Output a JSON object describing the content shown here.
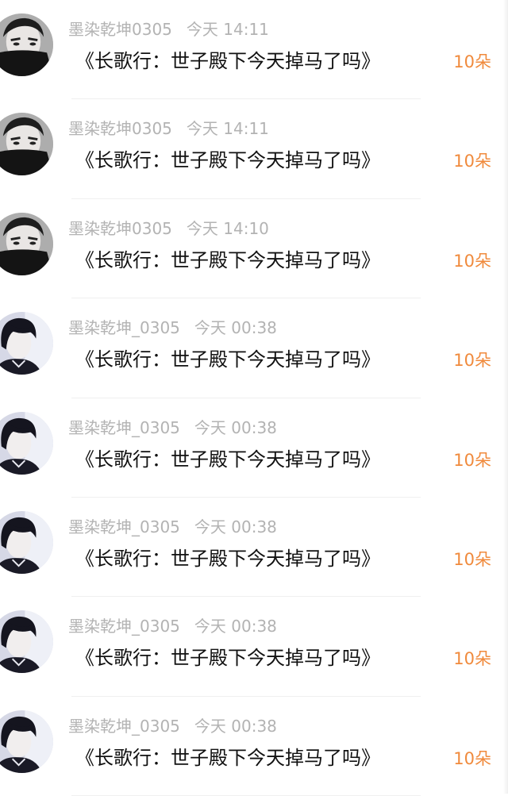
{
  "messages": [
    {
      "username": "墨染乾坤0305",
      "time": "今天 14:11",
      "content": "《长歌行：世子殿下今天掉马了吗》",
      "gift": "10朵",
      "avatar_icon": "masked-man-avatar-icon"
    },
    {
      "username": "墨染乾坤0305",
      "time": "今天 14:11",
      "content": "《长歌行：世子殿下今天掉马了吗》",
      "gift": "10朵",
      "avatar_icon": "masked-man-avatar-icon"
    },
    {
      "username": "墨染乾坤0305",
      "time": "今天 14:10",
      "content": "《长歌行：世子殿下今天掉马了吗》",
      "gift": "10朵",
      "avatar_icon": "masked-man-avatar-icon"
    },
    {
      "username": "墨染乾坤_0305",
      "time": "今天 00:38",
      "content": "《长歌行：世子殿下今天掉马了吗》",
      "gift": "10朵",
      "avatar_icon": "dark-hair-portrait-avatar-icon"
    },
    {
      "username": "墨染乾坤_0305",
      "time": "今天 00:38",
      "content": "《长歌行：世子殿下今天掉马了吗》",
      "gift": "10朵",
      "avatar_icon": "dark-hair-portrait-avatar-icon"
    },
    {
      "username": "墨染乾坤_0305",
      "time": "今天 00:38",
      "content": "《长歌行：世子殿下今天掉马了吗》",
      "gift": "10朵",
      "avatar_icon": "dark-hair-portrait-avatar-icon"
    },
    {
      "username": "墨染乾坤_0305",
      "time": "今天 00:38",
      "content": "《长歌行：世子殿下今天掉马了吗》",
      "gift": "10朵",
      "avatar_icon": "dark-hair-portrait-avatar-icon"
    },
    {
      "username": "墨染乾坤_0305",
      "time": "今天 00:38",
      "content": "《长歌行：世子殿下今天掉马了吗》",
      "gift": "10朵",
      "avatar_icon": "dark-hair-portrait-avatar-icon"
    }
  ],
  "colors": {
    "username": "#b3b3b3",
    "content": "#111111",
    "gift": "#f08a3c",
    "separator": "#f0f0f0"
  }
}
